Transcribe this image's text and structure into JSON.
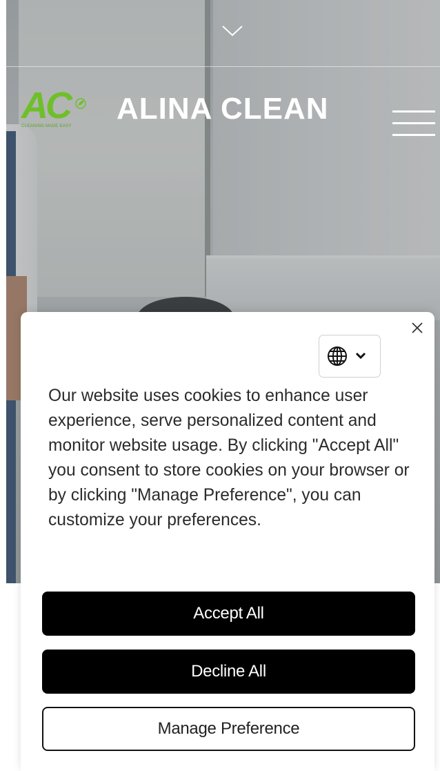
{
  "header": {
    "site_name": "ALINA CLEAN",
    "logo": {
      "letters": "AC",
      "tagline": "CLEANING MADE EASY",
      "color": "#6fbf2b"
    },
    "icons": {
      "scroll_indicator": "chevron-down-icon",
      "menu": "hamburger-menu-icon"
    }
  },
  "cookie_banner": {
    "message": "Our website uses cookies to enhance user experience, serve personalized content and monitor website usage. By clicking \"Accept All\" you consent to store cookies on your browser or by clicking \"Manage Preference\", you can customize your preferences.",
    "buttons": {
      "accept": "Accept All",
      "decline": "Decline All",
      "manage": "Manage Preference"
    },
    "icons": {
      "close": "close-icon",
      "language": "globe-icon",
      "language_dropdown": "chevron-down-icon"
    },
    "colors": {
      "primary_button": "#000000",
      "primary_text": "#ffffff",
      "body_text": "#2b2b2b"
    }
  }
}
